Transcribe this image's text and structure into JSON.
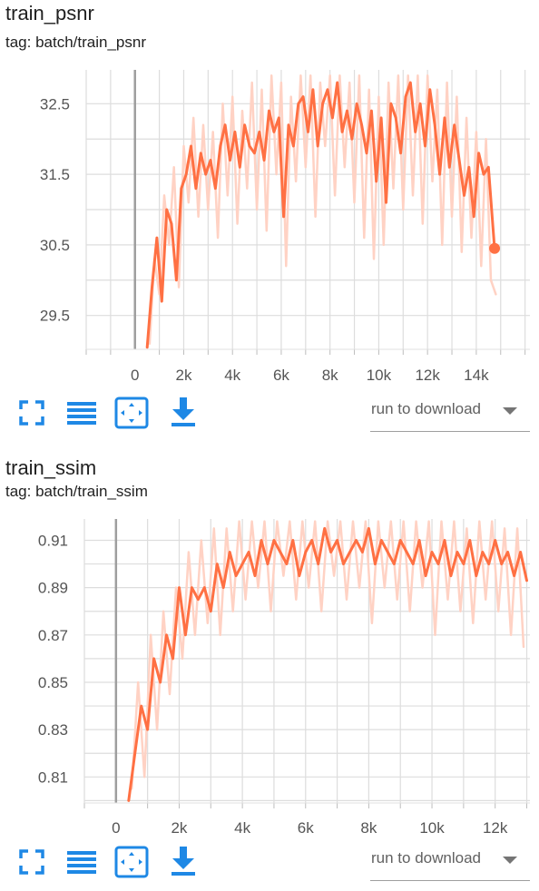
{
  "colors": {
    "line": "#ff7043",
    "raw": "#ffd2c4",
    "grid": "#dddddd",
    "zeroline": "#9e9e9e",
    "icon": "#1e88e5"
  },
  "icons": [
    "fit-domain-icon",
    "toggle-log-scale-icon",
    "expand-chart-icon",
    "download-icon"
  ],
  "cards": [
    {
      "title": "train_psnr",
      "tag": "tag: batch/train_psnr",
      "download_label": "run to download",
      "chart_data": {
        "type": "line",
        "title": "train_psnr",
        "xlabel": "",
        "ylabel": "",
        "xlim": [
          -2000,
          16200
        ],
        "ylim": [
          29.02,
          32.98
        ],
        "x_ticks": [
          0,
          2000,
          4000,
          6000,
          8000,
          10000,
          12000,
          14000
        ],
        "x_tick_labels": [
          "0",
          "2k",
          "4k",
          "6k",
          "8k",
          "10k",
          "12k",
          "14k"
        ],
        "y_ticks": [
          29.5,
          30.5,
          31.5,
          32.5
        ],
        "y_tick_labels": [
          "29.5",
          "30.5",
          "31.5",
          "32.5"
        ],
        "grid": true,
        "series": [
          {
            "smoothed": true,
            "x": [
              500,
              700,
              900,
              1100,
              1300,
              1500,
              1700,
              1900,
              2100,
              2300,
              2500,
              2700,
              2900,
              3100,
              3300,
              3500,
              3700,
              3900,
              4100,
              4300,
              4500,
              4700,
              4900,
              5100,
              5300,
              5500,
              5700,
              5900,
              6100,
              6300,
              6500,
              6700,
              6900,
              7100,
              7300,
              7500,
              7700,
              7900,
              8100,
              8300,
              8500,
              8700,
              8900,
              9100,
              9300,
              9500,
              9700,
              9900,
              10100,
              10300,
              10500,
              10700,
              10900,
              11100,
              11300,
              11500,
              11700,
              11900,
              12100,
              12300,
              12500,
              12700,
              12900,
              13100,
              13300,
              13500,
              13700,
              13900,
              14100,
              14300,
              14500,
              14750
            ],
            "values": [
              29.05,
              29.9,
              30.6,
              29.7,
              31.0,
              30.8,
              30.0,
              31.3,
              31.5,
              31.9,
              31.3,
              31.8,
              31.5,
              31.7,
              31.3,
              31.9,
              32.2,
              31.7,
              32.1,
              31.6,
              32.2,
              31.9,
              31.8,
              32.1,
              31.7,
              32.4,
              32.1,
              32.3,
              30.9,
              32.2,
              31.9,
              32.5,
              32.6,
              32.1,
              32.7,
              31.9,
              32.5,
              32.7,
              32.3,
              32.8,
              32.1,
              32.4,
              32.0,
              32.5,
              32.2,
              31.8,
              32.4,
              31.4,
              32.3,
              31.1,
              32.5,
              32.3,
              31.8,
              32.6,
              32.8,
              32.1,
              32.5,
              31.9,
              32.7,
              32.2,
              31.5,
              32.3,
              31.6,
              32.2,
              31.7,
              31.2,
              31.6,
              30.9,
              31.8,
              31.5,
              31.6,
              30.45
            ],
            "end_marker": true
          },
          {
            "smoothed": false,
            "x": [
              600,
              800,
              1000,
              1200,
              1400,
              1600,
              1800,
              2000,
              2200,
              2400,
              2600,
              2800,
              3000,
              3200,
              3400,
              3600,
              3800,
              4000,
              4200,
              4400,
              4600,
              4800,
              5000,
              5200,
              5400,
              5600,
              5800,
              6000,
              6200,
              6400,
              6600,
              6800,
              7000,
              7200,
              7400,
              7600,
              7800,
              8000,
              8200,
              8400,
              8600,
              8800,
              9000,
              9200,
              9400,
              9600,
              9800,
              10000,
              10200,
              10400,
              10600,
              10800,
              11000,
              11200,
              11400,
              11600,
              11800,
              12000,
              12200,
              12400,
              12600,
              12800,
              13000,
              13200,
              13400,
              13600,
              13800,
              14000,
              14200,
              14400,
              14600,
              14800
            ],
            "values": [
              29.1,
              30.3,
              29.8,
              31.2,
              30.5,
              31.6,
              29.9,
              31.9,
              31.1,
              32.3,
              30.9,
              32.2,
              31.0,
              32.1,
              30.6,
              32.5,
              31.2,
              32.6,
              30.8,
              32.4,
              31.3,
              32.8,
              31.0,
              32.7,
              30.7,
              32.9,
              31.5,
              32.8,
              30.2,
              32.6,
              31.4,
              32.9,
              31.6,
              32.9,
              30.9,
              32.8,
              31.9,
              32.9,
              31.2,
              32.9,
              31.6,
              32.8,
              31.1,
              32.9,
              30.6,
              32.7,
              30.3,
              32.6,
              30.5,
              32.8,
              31.3,
              32.9,
              31.0,
              32.9,
              31.2,
              32.9,
              30.8,
              32.9,
              31.4,
              32.7,
              30.5,
              32.8,
              30.9,
              32.6,
              30.4,
              32.3,
              30.6,
              32.1,
              30.2,
              32.0,
              30.0,
              29.8
            ]
          }
        ]
      }
    },
    {
      "title": "train_ssim",
      "tag": "tag: batch/train_ssim",
      "download_label": "run to download",
      "chart_data": {
        "type": "line",
        "title": "train_ssim",
        "xlabel": "",
        "ylabel": "",
        "xlim": [
          -1000,
          13100
        ],
        "ylim": [
          0.799,
          0.919
        ],
        "x_ticks": [
          0,
          2000,
          4000,
          6000,
          8000,
          10000,
          12000
        ],
        "x_tick_labels": [
          "0",
          "2k",
          "4k",
          "6k",
          "8k",
          "10k",
          "12k"
        ],
        "y_ticks": [
          0.81,
          0.83,
          0.85,
          0.87,
          0.89,
          0.91
        ],
        "y_tick_labels": [
          "0.81",
          "0.83",
          "0.85",
          "0.87",
          "0.89",
          "0.91"
        ],
        "grid": true,
        "series": [
          {
            "smoothed": true,
            "x": [
              400,
              600,
              800,
              1000,
              1200,
              1400,
              1600,
              1800,
              2000,
              2200,
              2400,
              2600,
              2800,
              3000,
              3200,
              3400,
              3600,
              3800,
              4000,
              4200,
              4400,
              4600,
              4800,
              5000,
              5200,
              5400,
              5600,
              5800,
              6000,
              6200,
              6400,
              6600,
              6800,
              7000,
              7200,
              7600,
              7800,
              8000,
              8200,
              8400,
              8600,
              8800,
              9000,
              9200,
              9400,
              9600,
              9800,
              10000,
              10200,
              10400,
              10600,
              10800,
              11000,
              11200,
              11400,
              11600,
              11800,
              12000,
              12200,
              12400,
              12600,
              12800,
              13000
            ],
            "values": [
              0.8,
              0.82,
              0.84,
              0.83,
              0.86,
              0.85,
              0.87,
              0.86,
              0.89,
              0.87,
              0.89,
              0.885,
              0.89,
              0.88,
              0.9,
              0.89,
              0.905,
              0.895,
              0.9,
              0.905,
              0.895,
              0.91,
              0.9,
              0.91,
              0.905,
              0.9,
              0.91,
              0.895,
              0.905,
              0.91,
              0.9,
              0.915,
              0.905,
              0.91,
              0.9,
              0.91,
              0.905,
              0.915,
              0.9,
              0.91,
              0.905,
              0.9,
              0.91,
              0.905,
              0.9,
              0.91,
              0.895,
              0.905,
              0.9,
              0.91,
              0.895,
              0.905,
              0.9,
              0.91,
              0.895,
              0.905,
              0.9,
              0.91,
              0.9,
              0.905,
              0.895,
              0.905,
              0.893
            ]
          },
          {
            "smoothed": false,
            "x": [
              500,
              700,
              900,
              1100,
              1300,
              1500,
              1700,
              1900,
              2100,
              2300,
              2500,
              2700,
              2900,
              3100,
              3300,
              3500,
              3700,
              3900,
              4100,
              4300,
              4500,
              4700,
              4900,
              5100,
              5300,
              5500,
              5700,
              5900,
              6100,
              6300,
              6500,
              6700,
              6900,
              7100,
              7300,
              7500,
              7700,
              7900,
              8100,
              8300,
              8500,
              8700,
              8900,
              9100,
              9300,
              9500,
              9700,
              9900,
              10100,
              10300,
              10500,
              10700,
              10900,
              11100,
              11300,
              11500,
              11700,
              11900,
              12100,
              12300,
              12500,
              12700,
              12900
            ],
            "values": [
              0.805,
              0.85,
              0.81,
              0.87,
              0.83,
              0.88,
              0.845,
              0.89,
              0.86,
              0.905,
              0.87,
              0.91,
              0.875,
              0.915,
              0.87,
              0.915,
              0.88,
              0.918,
              0.885,
              0.918,
              0.89,
              0.918,
              0.88,
              0.918,
              0.895,
              0.918,
              0.885,
              0.918,
              0.89,
              0.918,
              0.88,
              0.918,
              0.895,
              0.918,
              0.885,
              0.918,
              0.89,
              0.918,
              0.875,
              0.918,
              0.89,
              0.918,
              0.885,
              0.918,
              0.88,
              0.918,
              0.89,
              0.918,
              0.87,
              0.918,
              0.885,
              0.918,
              0.88,
              0.915,
              0.875,
              0.918,
              0.885,
              0.918,
              0.88,
              0.915,
              0.87,
              0.915,
              0.865
            ]
          }
        ]
      }
    }
  ]
}
